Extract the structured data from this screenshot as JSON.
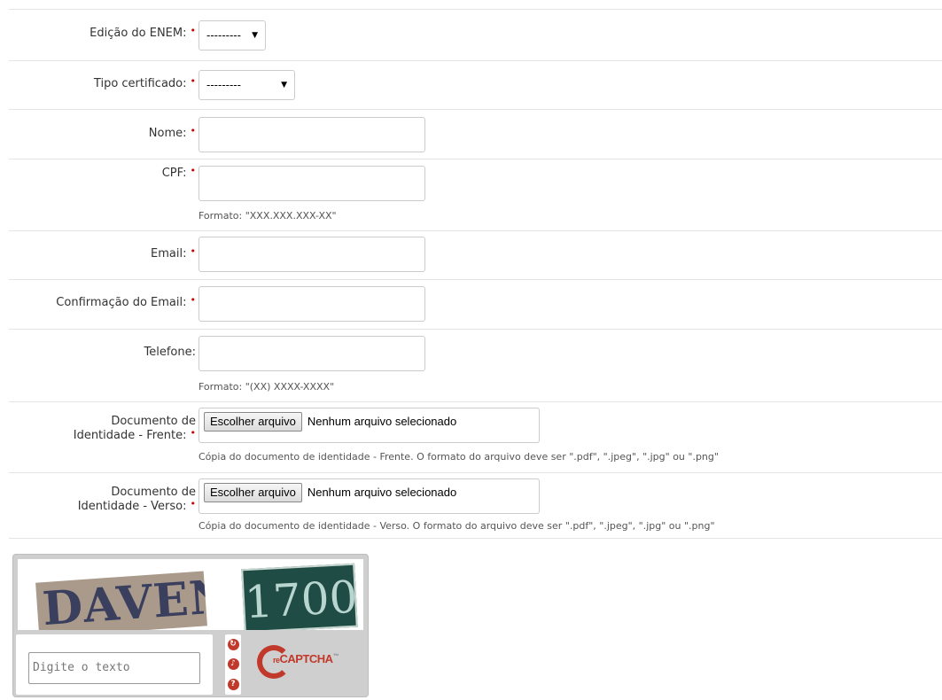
{
  "form": {
    "edition": {
      "label": "Edição do ENEM:",
      "value": "---------"
    },
    "cert_type": {
      "label": "Tipo certificado:",
      "value": "---------"
    },
    "name": {
      "label": "Nome:"
    },
    "cpf": {
      "label": "CPF:",
      "help": "Formato: \"XXX.XXX.XXX-XX\""
    },
    "email": {
      "label": "Email:"
    },
    "email_confirm": {
      "label": "Confirmação do Email:"
    },
    "phone": {
      "label": "Telefone:",
      "help": "Formato: \"(XX) XXXX-XXXX\""
    },
    "doc_front": {
      "label_line1": "Documento de",
      "label_line2": "Identidade - Frente:",
      "button": "Escolher arquivo",
      "status": "Nenhum arquivo selecionado",
      "help": "Cópia do documento de identidade - Frente. O formato do arquivo deve ser \".pdf\", \".jpeg\", \".jpg\" ou \".png\""
    },
    "doc_back": {
      "label_line1": "Documento de",
      "label_line2": "Identidade - Verso:",
      "button": "Escolher arquivo",
      "status": "Nenhum arquivo selecionado",
      "help": "Cópia do documento de identidade - Verso. O formato do arquivo deve ser \".pdf\", \".jpeg\", \".jpg\" ou \".png\""
    },
    "required_mark": "•"
  },
  "captcha": {
    "word1": "DAVEN",
    "word2": "1700",
    "placeholder": "Digite o texto",
    "logo": "CAPTCHA",
    "logo_prefix": "re",
    "logo_tm": "™",
    "icons": [
      "refresh-icon",
      "audio-icon",
      "help-icon"
    ]
  }
}
